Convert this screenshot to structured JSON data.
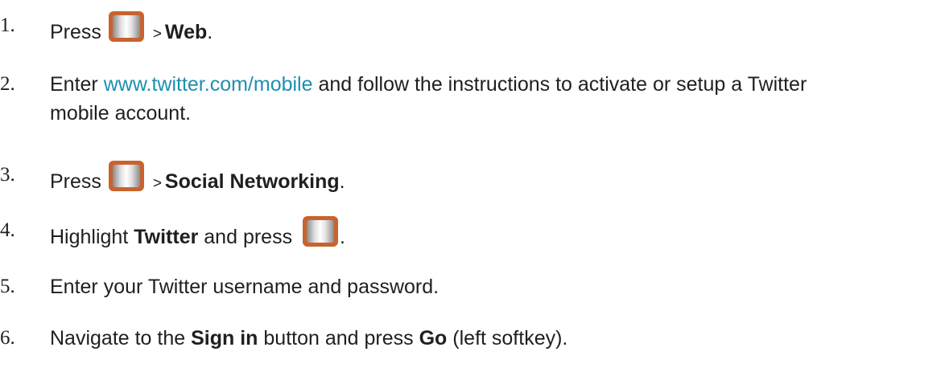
{
  "steps": [
    {
      "number": "1.",
      "press": "Press",
      "sep": ">",
      "target": "Web",
      "end": "."
    },
    {
      "number": "2.",
      "enter": "Enter",
      "link": "www.twitter.com/mobile",
      "rest_line1": "and follow the instructions to activate or setup a Twitter",
      "rest_line2": "mobile account."
    },
    {
      "number": "3.",
      "press": "Press",
      "sep": ">",
      "target": "Social Networking",
      "end": "."
    },
    {
      "number": "4.",
      "highlight": "Highlight",
      "target": "Twitter",
      "and_press": "and press",
      "end": "."
    },
    {
      "number": "5.",
      "text": "Enter your Twitter username and password."
    },
    {
      "number": "6.",
      "navigate": "Navigate to the",
      "target": "Sign in",
      "button_and_press": "button and press",
      "go": "Go",
      "rest": "(left softkey)."
    }
  ],
  "icons": {
    "menu_key": "menu-key-icon",
    "ok_key": "ok-key-icon",
    "accent": "#c8632f",
    "link_color": "#1f8fb0"
  }
}
